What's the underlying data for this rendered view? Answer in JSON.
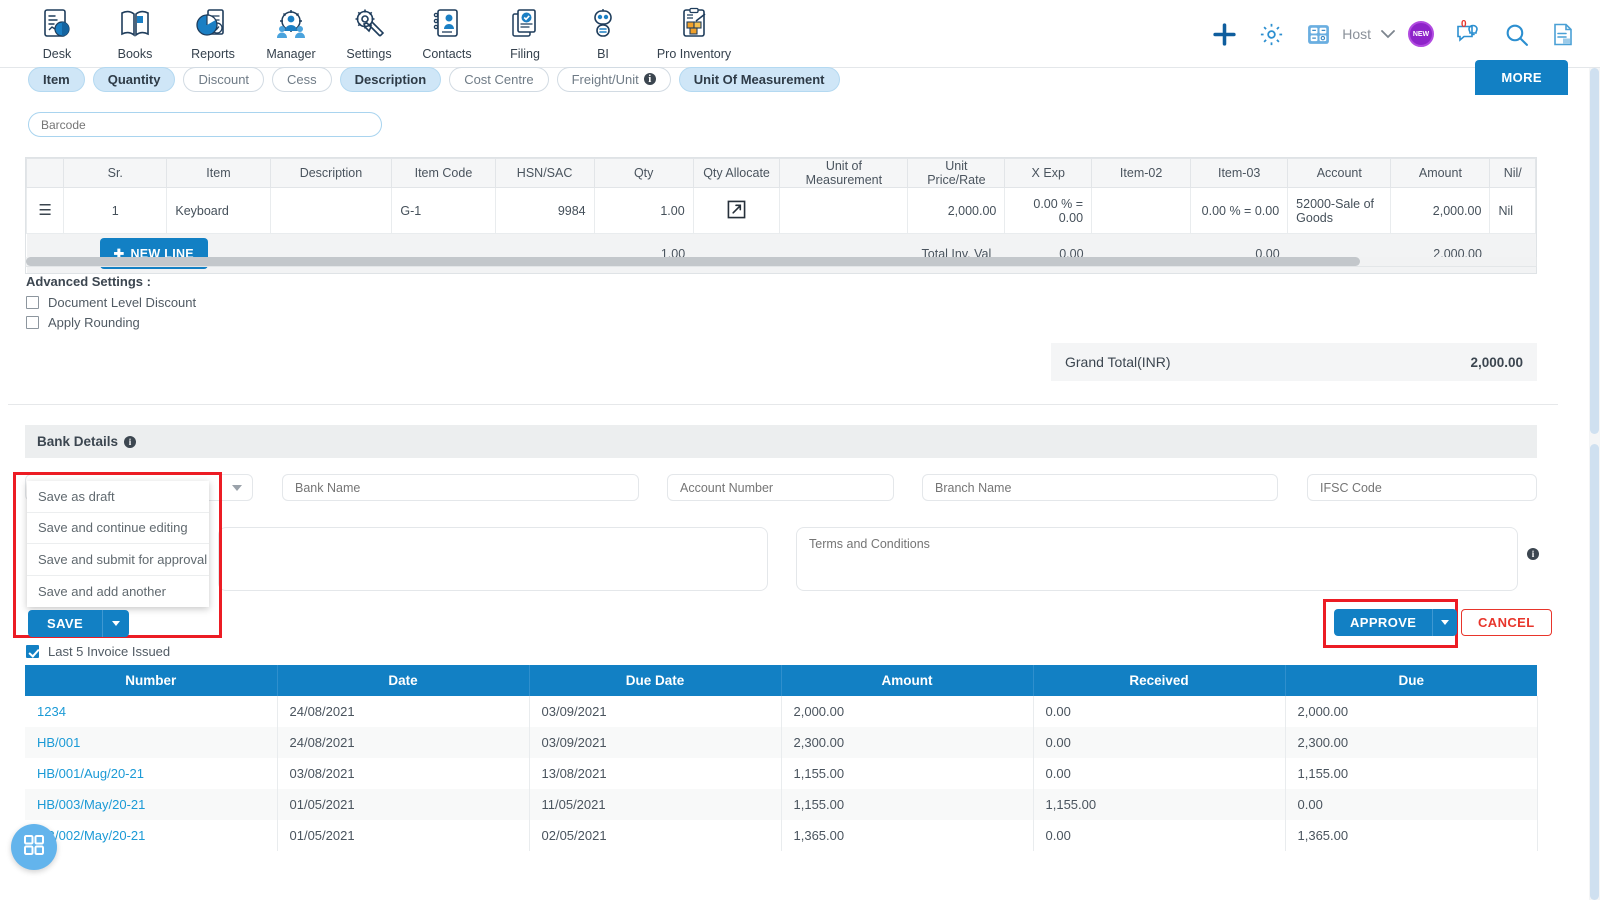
{
  "topnav": {
    "items": [
      {
        "label": "Desk",
        "icon": "dashboard-icon"
      },
      {
        "label": "Books",
        "icon": "book-icon"
      },
      {
        "label": "Reports",
        "icon": "reports-chart-icon"
      },
      {
        "label": "Manager",
        "icon": "manager-gear-people-icon"
      },
      {
        "label": "Settings",
        "icon": "settings-tools-icon"
      },
      {
        "label": "Contacts",
        "icon": "contacts-icon"
      },
      {
        "label": "Filing",
        "icon": "filing-document-icon"
      },
      {
        "label": "BI",
        "icon": "bi-robot-icon"
      },
      {
        "label": "Pro Inventory",
        "icon": "pro-inventory-icon"
      }
    ],
    "right": {
      "add_icon": "plus-icon",
      "settings_icon": "gear-icon",
      "calculator_icon": "calculator-icon",
      "host_label": "Host",
      "host_chevron_icon": "chevron-down-icon",
      "new_badge_label": "NEW",
      "notification_icon": "notification-bell-icon",
      "notification_count": "0",
      "search_icon": "search-icon",
      "notes_icon": "notes-document-icon"
    },
    "accent_color": "#1280c4"
  },
  "chips": [
    {
      "label": "Item",
      "active": true,
      "info": false
    },
    {
      "label": "Quantity",
      "active": true,
      "info": false
    },
    {
      "label": "Discount",
      "active": false,
      "info": false
    },
    {
      "label": "Cess",
      "active": false,
      "info": false
    },
    {
      "label": "Description",
      "active": true,
      "info": false
    },
    {
      "label": "Cost Centre",
      "active": false,
      "info": false
    },
    {
      "label": "Freight/Unit",
      "active": false,
      "info": true
    },
    {
      "label": "Unit Of Measurement",
      "active": true,
      "info": false
    }
  ],
  "more_button_label": "MORE",
  "barcode": {
    "placeholder": "Barcode",
    "value": ""
  },
  "item_grid": {
    "columns": [
      "",
      "Sr.",
      "Item",
      "Description",
      "Item Code",
      "HSN/SAC",
      "Qty",
      "Qty Allocate",
      "Unit of Measurement",
      "Unit Price/Rate",
      "X Exp",
      "Item-02",
      "Item-03",
      "Account",
      "Amount",
      "Nil/"
    ],
    "rows": [
      {
        "menu_icon": "row-menu-icon",
        "sr": "1",
        "item": "Keyboard",
        "description": "",
        "item_code": "G-1",
        "hsn_sac": "9984",
        "qty": "1.00",
        "qty_allocate_icon": "external-link-icon",
        "uom": "",
        "unit_price": "2,000.00",
        "x_exp": "0.00 % = 0.00",
        "item_02": "",
        "item_03": "0.00 % = 0.00",
        "account": "52000-Sale of Goods",
        "amount": "2,000.00",
        "nil": "Nil"
      }
    ],
    "footer": {
      "new_line_label": "NEW LINE",
      "qty_total": "1.00",
      "total_label": "Total Inv. Val",
      "x_exp_total": "0.00",
      "item_03_total": "0.00",
      "amount_total": "2,000.00"
    }
  },
  "advanced_settings": {
    "title": "Advanced Settings :",
    "options": [
      {
        "label": "Document Level Discount",
        "checked": false
      },
      {
        "label": "Apply Rounding",
        "checked": false
      }
    ]
  },
  "grand_total": {
    "label": "Grand Total(INR)",
    "value": "2,000.00"
  },
  "bank_details": {
    "title": "Bank Details",
    "info_icon": "info-icon",
    "fields": [
      {
        "name": "bank-select",
        "placeholder": "",
        "value": ""
      },
      {
        "name": "bank-name",
        "placeholder": "Bank Name",
        "value": ""
      },
      {
        "name": "account-number",
        "placeholder": "Account Number",
        "value": ""
      },
      {
        "name": "branch-name",
        "placeholder": "Branch Name",
        "value": ""
      },
      {
        "name": "ifsc-code",
        "placeholder": "IFSC Code",
        "value": ""
      }
    ],
    "narration_placeholder": "",
    "terms_placeholder": "Terms and Conditions"
  },
  "save_menu": {
    "items": [
      "Save as draft",
      "Save and continue editing",
      "Save and submit for approval",
      "Save and add another"
    ],
    "save_label": "SAVE",
    "caret_icon": "caret-down-icon",
    "highlight_color": "#ec1c24"
  },
  "actions": {
    "approve_label": "APPROVE",
    "approve_caret_icon": "caret-down-icon",
    "cancel_label": "CANCEL",
    "highlight_color": "#ec1c24"
  },
  "last5": {
    "checkbox_label": "Last 5 Invoice Issued",
    "checked": true,
    "columns": [
      "Number",
      "Date",
      "Due Date",
      "Amount",
      "Received",
      "Due"
    ],
    "rows": [
      {
        "number": "1234",
        "date": "24/08/2021",
        "due_date": "03/09/2021",
        "amount": "2,000.00",
        "received": "0.00",
        "due": "2,000.00"
      },
      {
        "number": "HB/001",
        "date": "24/08/2021",
        "due_date": "03/09/2021",
        "amount": "2,300.00",
        "received": "0.00",
        "due": "2,300.00"
      },
      {
        "number": "HB/001/Aug/20-21",
        "date": "03/08/2021",
        "due_date": "13/08/2021",
        "amount": "1,155.00",
        "received": "0.00",
        "due": "1,155.00"
      },
      {
        "number": "HB/003/May/20-21",
        "date": "01/05/2021",
        "due_date": "11/05/2021",
        "amount": "1,155.00",
        "received": "1,155.00",
        "due": "0.00"
      },
      {
        "number": "HB/002/May/20-21",
        "date": "01/05/2021",
        "due_date": "02/05/2021",
        "amount": "1,365.00",
        "received": "0.00",
        "due": "1,365.00"
      }
    ]
  },
  "fab": {
    "icon": "grid-apps-icon"
  }
}
